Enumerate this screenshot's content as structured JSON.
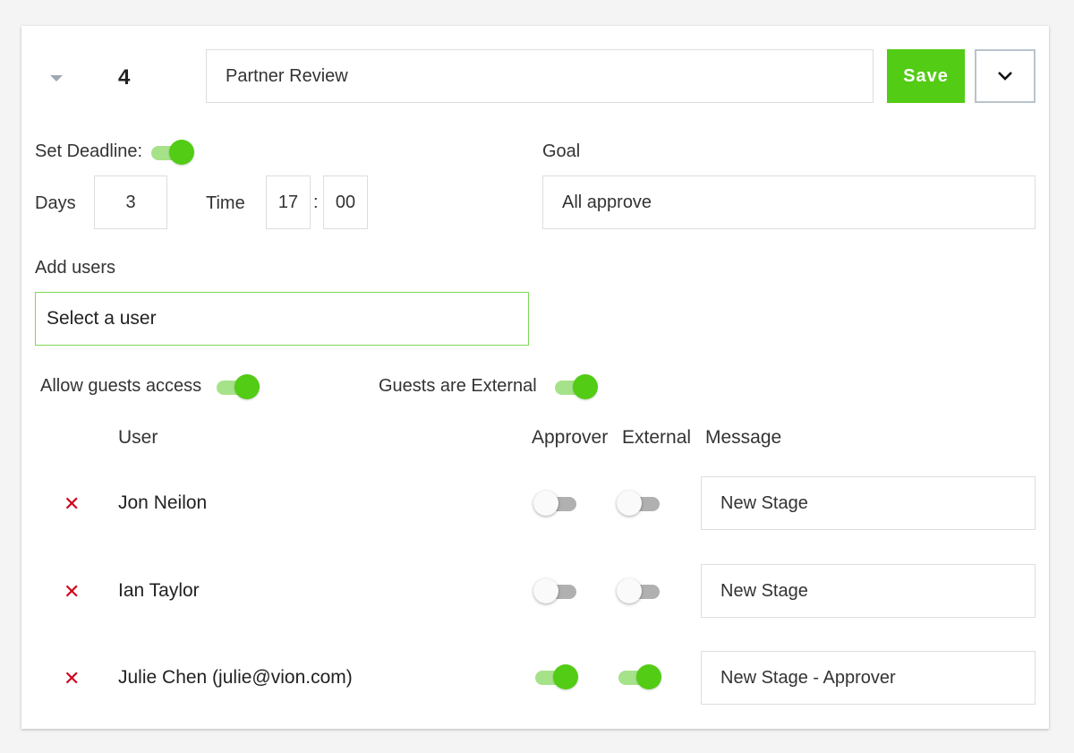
{
  "stage": {
    "number": "4",
    "name": "Partner Review",
    "save_label": "Save",
    "menu_icon": "chevron-down-icon",
    "collapse_icon": "caret-down-icon"
  },
  "deadline": {
    "label": "Set Deadline:",
    "enabled": true,
    "days_label": "Days",
    "days": "3",
    "time_label": "Time",
    "hours": "17",
    "separator": ":",
    "minutes": "00"
  },
  "goal": {
    "label": "Goal",
    "value": "All approve"
  },
  "add_users": {
    "label": "Add users",
    "placeholder": "Select a user"
  },
  "guests": {
    "allow_label": "Allow guests access",
    "allow_enabled": true,
    "external_label": "Guests are External",
    "external_enabled": true
  },
  "table": {
    "headers": {
      "user": "User",
      "approver": "Approver",
      "external": "External",
      "message": "Message"
    },
    "rows": [
      {
        "remove_icon": "close-icon",
        "name": "Jon Neilon",
        "approver": false,
        "external": false,
        "message": "New Stage"
      },
      {
        "remove_icon": "close-icon",
        "name": "Ian Taylor",
        "approver": false,
        "external": false,
        "message": "New Stage"
      },
      {
        "remove_icon": "close-icon",
        "name": "Julie Chen (julie@vion.com)",
        "approver": true,
        "external": true,
        "message": "New Stage - Approver"
      }
    ]
  },
  "colors": {
    "accent": "#52cc14",
    "accent_light": "#a6e28a",
    "remove": "#d0021b",
    "input_focus_border": "#7ed957"
  }
}
